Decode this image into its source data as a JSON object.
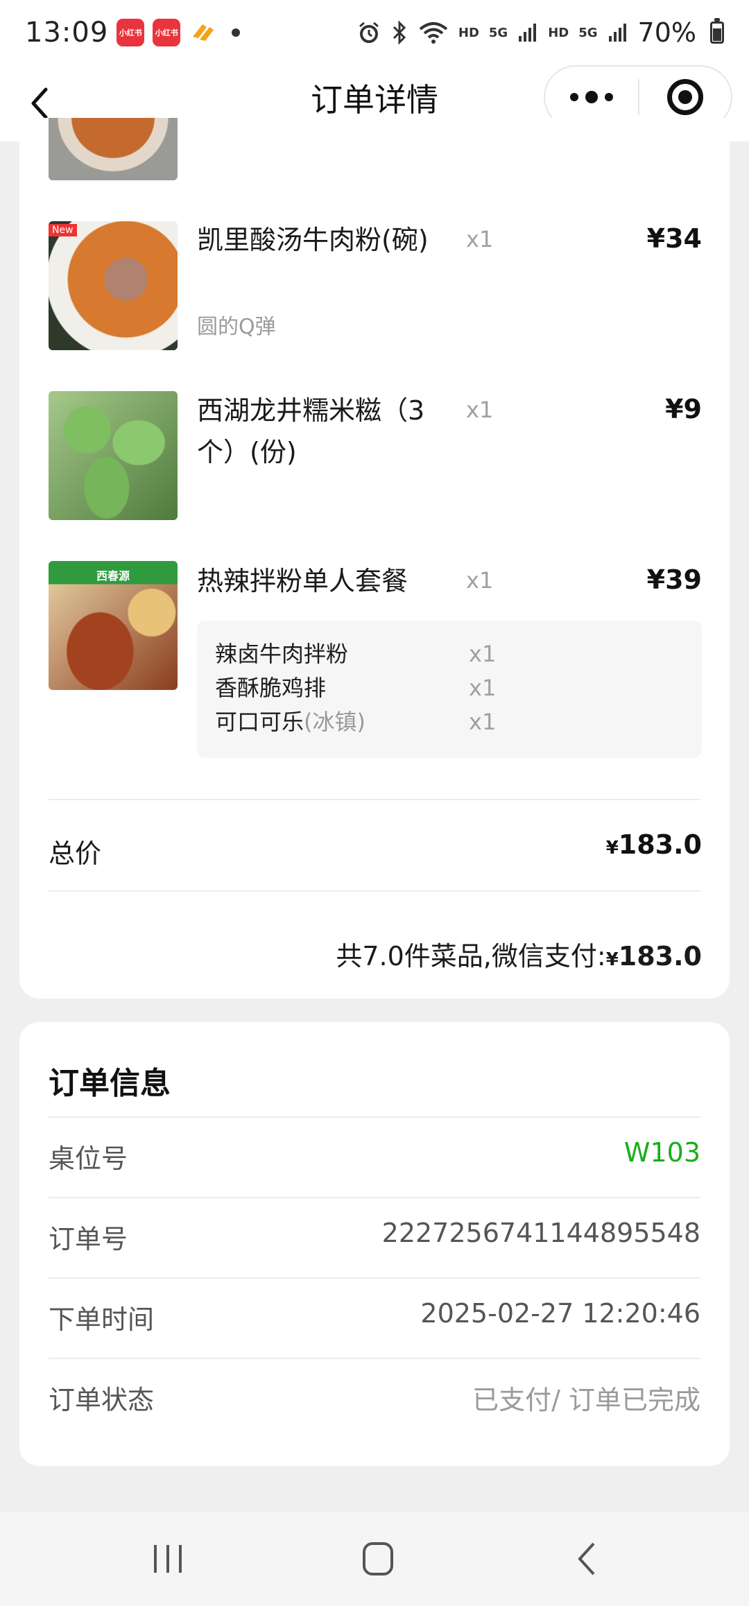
{
  "status_bar": {
    "time": "13:09",
    "app_badges": [
      "小红书",
      "小红书"
    ],
    "hd1": "HD",
    "net1": "5G",
    "hd2": "HD",
    "net2": "5G",
    "battery": "70%"
  },
  "nav": {
    "title": "订单详情"
  },
  "items": [
    {
      "name": "凯里酸汤牛肉粉(碗)",
      "spec": "圆的Q弹",
      "qty": "x1",
      "price": "¥34"
    },
    {
      "name": "西湖龙井糯米糍（3个）(份)",
      "qty": "x1",
      "price": "¥9"
    },
    {
      "name": "热辣拌粉单人套餐",
      "qty": "x1",
      "price": "¥39",
      "sub_items": [
        {
          "name": "辣卤牛肉拌粉",
          "note": "",
          "qty": "x1"
        },
        {
          "name": "香酥脆鸡排",
          "note": "",
          "qty": "x1"
        },
        {
          "name": "可口可乐",
          "note": "(冰镇)",
          "qty": "x1"
        }
      ]
    }
  ],
  "thumb_labels": {
    "new_tag": "New",
    "brand": "西春源"
  },
  "total": {
    "label": "总价",
    "currency": "¥",
    "amount": "183.0"
  },
  "summary": {
    "text": "共7.0件菜品,微信支付:",
    "currency": "¥",
    "amount": "183.0"
  },
  "order_info": {
    "title": "订单信息",
    "rows": [
      {
        "label": "桌位号",
        "value": "W103"
      },
      {
        "label": "订单号",
        "value": "2227256741144895548"
      },
      {
        "label": "下单时间",
        "value": "2025-02-27 12:20:46"
      },
      {
        "label": "订单状态",
        "value": "已支付/ 订单已完成"
      }
    ]
  },
  "colors": {
    "accent_green": "#1aad19",
    "muted_text": "#9a9a9a",
    "background": "#efefef"
  }
}
